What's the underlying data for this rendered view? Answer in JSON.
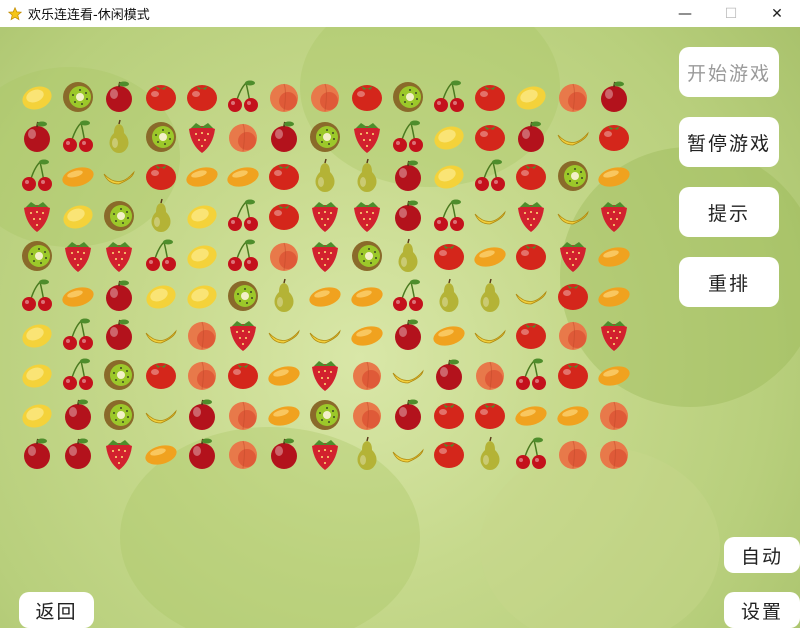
{
  "window": {
    "title": "欢乐连连看-休闲模式",
    "minimize": "—",
    "maximize": "☐",
    "close": "✕"
  },
  "side_buttons": {
    "start": "开始游戏",
    "pause": "暂停游戏",
    "hint": "提示",
    "shuffle": "重排"
  },
  "bottom_buttons": {
    "back": "返回",
    "auto": "自动",
    "settings": "设置"
  },
  "board": {
    "rows": [
      [
        "lemon",
        "kiwi",
        "apple",
        "tomato",
        "tomato",
        "cherry",
        "peach",
        "peach",
        "tomato",
        "kiwi",
        "cherry",
        "tomato",
        "lemon",
        "peach",
        "apple"
      ],
      [
        "apple",
        "cherry",
        "pear",
        "kiwi",
        "strawberry",
        "peach",
        "apple",
        "kiwi",
        "strawberry",
        "cherry",
        "lemon",
        "tomato",
        "apple",
        "banana",
        "tomato"
      ],
      [
        "cherry",
        "mango",
        "banana",
        "tomato",
        "mango",
        "mango",
        "tomato",
        "pear",
        "pear",
        "apple",
        "lemon",
        "cherry",
        "tomato",
        "kiwi",
        "mango"
      ],
      [
        "strawberry",
        "lemon",
        "kiwi",
        "pear",
        "lemon",
        "cherry",
        "tomato",
        "strawberry",
        "strawberry",
        "apple",
        "cherry",
        "banana",
        "strawberry",
        "banana",
        "strawberry"
      ],
      [
        "kiwi",
        "strawberry",
        "strawberry",
        "cherry",
        "lemon",
        "cherry",
        "peach",
        "strawberry",
        "kiwi",
        "pear",
        "tomato",
        "mango",
        "tomato",
        "strawberry",
        "mango"
      ],
      [
        "cherry",
        "mango",
        "apple",
        "lemon",
        "lemon",
        "kiwi",
        "pear",
        "mango",
        "mango",
        "cherry",
        "pear",
        "pear",
        "banana",
        "tomato",
        "mango"
      ],
      [
        "lemon",
        "cherry",
        "apple",
        "banana",
        "peach",
        "strawberry",
        "banana",
        "banana",
        "mango",
        "apple",
        "mango",
        "banana",
        "tomato",
        "peach",
        "strawberry"
      ],
      [
        "lemon",
        "cherry",
        "kiwi",
        "tomato",
        "peach",
        "tomato",
        "mango",
        "strawberry",
        "peach",
        "banana",
        "apple",
        "peach",
        "cherry",
        "tomato",
        "mango"
      ],
      [
        "lemon",
        "apple",
        "kiwi",
        "banana",
        "apple",
        "peach",
        "mango",
        "kiwi",
        "peach",
        "apple",
        "tomato",
        "tomato",
        "mango",
        "mango",
        "peach"
      ],
      [
        "apple",
        "apple",
        "strawberry",
        "mango",
        "apple",
        "peach",
        "apple",
        "strawberry",
        "pear",
        "banana",
        "tomato",
        "pear",
        "cherry",
        "peach",
        "peach"
      ]
    ]
  },
  "colors": {
    "apple": "#b3121c",
    "tomato": "#d4261b",
    "peach": "#e8794a",
    "strawberry": "#d2212e",
    "lemon": "#f4d23a",
    "mango": "#f0a21f",
    "banana": "#f2cf3c",
    "pear": "#b4b336",
    "kiwi": "#8a6a2a",
    "cherry": "#c4111c",
    "leaf": "#4e8d2c"
  }
}
